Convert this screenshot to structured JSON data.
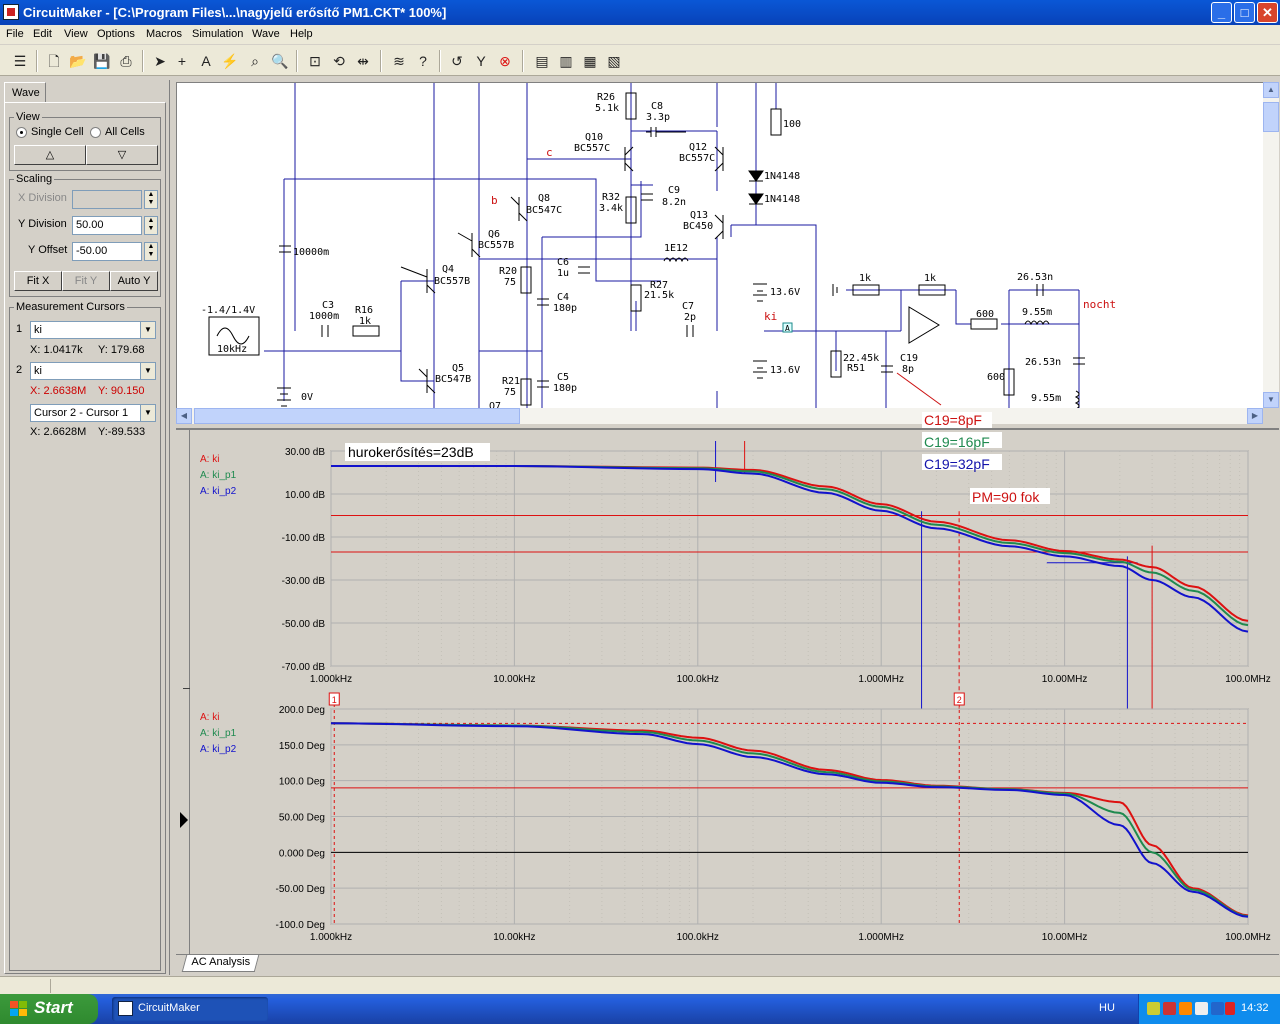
{
  "window": {
    "title": "CircuitMaker - [C:\\Program Files\\...\\nagyjelű erősítő PM1.CKT* 100%]",
    "min": "_",
    "max": "□",
    "close": "✕"
  },
  "menu": [
    "File",
    "Edit",
    "View",
    "Options",
    "Macros",
    "Simulation",
    "Wave",
    "Help"
  ],
  "leftpanel": {
    "tab": "Wave",
    "view": {
      "title": "View",
      "single": "Single Cell",
      "all": "All Cells",
      "up": "△",
      "down": "▽"
    },
    "scaling": {
      "title": "Scaling",
      "xdiv_label": "X Division",
      "xdiv_value": "",
      "ydiv_label": "Y Division",
      "ydiv_value": "50.00",
      "yoff_label": "Y Offset",
      "yoff_value": "-50.00",
      "fitx": "Fit X",
      "fity": "Fit Y",
      "autoy": "Auto Y"
    },
    "cursors": {
      "title": "Measurement Cursors",
      "c1": {
        "num": "1",
        "sel": "ki",
        "x": "X: 1.0417k",
        "y": "Y: 179.68"
      },
      "c2": {
        "num": "2",
        "sel": "ki",
        "x": "X: 2.6638M",
        "y": "Y: 90.150"
      },
      "diff": {
        "sel": "Cursor 2 - Cursor 1",
        "x": "X: 2.6628M",
        "y": "Y:-89.533"
      }
    },
    "colors": {
      "c2": "#cc0000"
    }
  },
  "schematic": {
    "labels": {
      "r26": "R26",
      "r26v": "5.1k",
      "c8": "C8",
      "c8v": "3.3p",
      "q10": "Q10",
      "q10t": "BC557C",
      "q12": "Q12",
      "q12t": "BC557C",
      "r100": "100",
      "d1": "1N4148",
      "d2": "1N4148",
      "c_node": "c",
      "b_node": "b",
      "q8": "Q8",
      "q8t": "BC547C",
      "r32": "R32",
      "r32v": "3.4k",
      "c9": "C9",
      "c9v": "8.2n",
      "q13": "Q13",
      "q13t": "BC450",
      "q6": "Q6",
      "q6t": "BC557B",
      "c10000": "10000m",
      "l1": "1E12",
      "r20": "R20",
      "r20v": "75",
      "c6": "C6",
      "c6v": "1u",
      "q4": "Q4",
      "q4t": "BC557B",
      "r27": "R27",
      "r27v": "21.5k",
      "v136a": "13.6V",
      "src": "-1.4/1.4V",
      "src_f": "10kHz",
      "c3": "C3",
      "c3v": "1000m",
      "r16": "R16",
      "r16v": "1k",
      "c4": "C4",
      "c4v": "180p",
      "c7": "C7",
      "c7v": "2p",
      "ki": "ki",
      "r1k_a": "1k",
      "r1k_b": "1k",
      "c2653a": "26.53n",
      "nocht": "nocht",
      "r600a": "600",
      "l955a": "9.55m",
      "r2245": "22.45k",
      "r51": "R51",
      "c19": "C19",
      "c19v": "8p",
      "q5": "Q5",
      "q5t": "BC547B",
      "r21": "R21",
      "r21v": "75",
      "c5": "C5",
      "c5v": "180p",
      "v136b": "13.6V",
      "r600b": "600",
      "c2653b": "26.53n",
      "l955b": "9.55m",
      "v0": "0V",
      "q7": "Q7",
      "probe": "A"
    }
  },
  "annotations": {
    "c19_8": "C19=8pF",
    "c19_16": "C19=16pF",
    "c19_32": "C19=32pF",
    "pm": "PM=90 fok",
    "loopgain": "hurokerősítés=23dB"
  },
  "chart_data": [
    {
      "type": "line",
      "title": "",
      "xlabel": "",
      "ylabel": "",
      "x_scale": "log",
      "xlim": [
        1000,
        100000000
      ],
      "ylim": [
        -70,
        30
      ],
      "grid": true,
      "xticks": [
        "1.000kHz",
        "10.00kHz",
        "100.0kHz",
        "1.000MHz",
        "10.00MHz",
        "100.0MHz"
      ],
      "yticks": [
        "30.00 dB",
        "10.00 dB",
        "-10.00 dB",
        "-30.00 dB",
        "-50.00 dB",
        "-70.00 dB"
      ],
      "legend": [
        "A: ki",
        "A: ki_p1",
        "A: ki_p2"
      ],
      "x": [
        1000,
        10000,
        100000,
        200000,
        500000,
        1000000,
        2000000,
        5000000,
        10000000,
        20000000,
        30000000,
        50000000,
        100000000
      ],
      "series": [
        {
          "name": "A: ki",
          "color": "#dd1111",
          "values": [
            23,
            23,
            22.3,
            21.2,
            13.5,
            5.3,
            -2.9,
            -11.5,
            -16.5,
            -20.5,
            -24,
            -33,
            -49
          ]
        },
        {
          "name": "A: ki_p1",
          "color": "#1f8a4f",
          "values": [
            23,
            23,
            22,
            20.5,
            12.2,
            4,
            -4.3,
            -12.8,
            -17.5,
            -21.5,
            -26.5,
            -35,
            -51
          ]
        },
        {
          "name": "A: ki_p2",
          "color": "#1212cc",
          "values": [
            23,
            23,
            21.6,
            19.5,
            10.5,
            2.2,
            -6,
            -14.3,
            -19,
            -23.5,
            -30,
            -38,
            -54
          ]
        }
      ],
      "markers": {
        "hline_0db": 0,
        "hline_m17db": -17,
        "vline_red_hz": 2660000,
        "vline_blue_hz": 1660000,
        "vline_blue2_hz": 22000000,
        "vline_red2_hz": 30000000
      }
    },
    {
      "type": "line",
      "title": "",
      "xlabel": "",
      "ylabel": "",
      "x_scale": "log",
      "xlim": [
        1000,
        100000000
      ],
      "ylim": [
        -100,
        200
      ],
      "grid": true,
      "xticks": [
        "1.000kHz",
        "10.00kHz",
        "100.0kHz",
        "1.000MHz",
        "10.00MHz",
        "100.0MHz"
      ],
      "yticks": [
        "200.0 Deg",
        "150.0 Deg",
        "100.0 Deg",
        "50.00 Deg",
        "0.000 Deg",
        "-50.00 Deg",
        "-100.0 Deg"
      ],
      "legend": [
        "A: ki",
        "A: ki_p1",
        "A: ki_p2"
      ],
      "x": [
        1000,
        10000,
        50000,
        100000,
        200000,
        500000,
        1000000,
        2000000,
        5000000,
        10000000,
        20000000,
        30000000,
        50000000,
        100000000
      ],
      "series": [
        {
          "name": "A: ki",
          "color": "#dd1111",
          "values": [
            180,
            177,
            170,
            160,
            142,
            115,
            101,
            93,
            88,
            83,
            70,
            10,
            -50,
            -88
          ]
        },
        {
          "name": "A: ki_p1",
          "color": "#1f8a4f",
          "values": [
            180,
            177,
            168,
            156,
            138,
            112,
            99,
            92,
            88,
            82,
            55,
            0,
            -52,
            -89
          ]
        },
        {
          "name": "A: ki_p2",
          "color": "#1212cc",
          "values": [
            180,
            176,
            165,
            151,
            133,
            109,
            97,
            91,
            87,
            80,
            38,
            -15,
            -55,
            -90
          ]
        }
      ],
      "cursors": [
        {
          "label": "1",
          "x_hz": 1041.7
        },
        {
          "label": "2",
          "x_hz": 2663800
        }
      ],
      "markers": {
        "hline_180": 180,
        "hline_90": 90,
        "hline_0": 0
      }
    }
  ],
  "bottom_tab": "AC Analysis",
  "taskbar": {
    "start": "Start",
    "task": "CircuitMaker",
    "lang": "HU",
    "clock": "14:32"
  }
}
